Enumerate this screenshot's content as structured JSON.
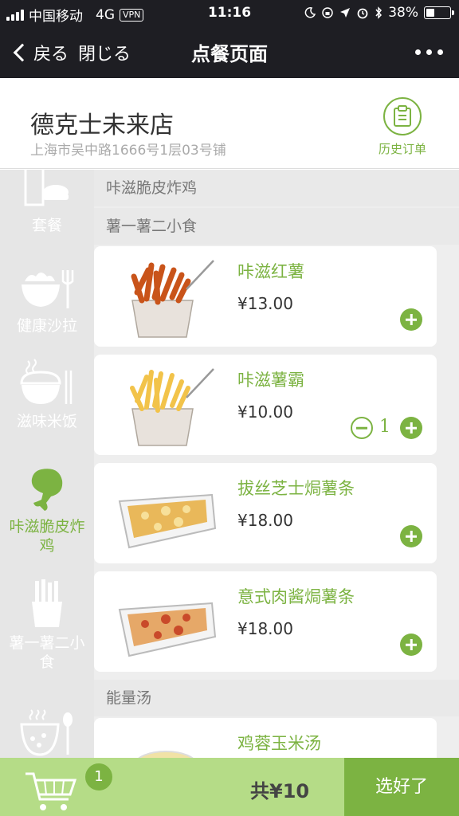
{
  "status_bar": {
    "carrier": "中国移动",
    "network": "4G",
    "vpn": "VPN",
    "time": "11:16",
    "battery": "38%",
    "battery_level": 0.38
  },
  "nav": {
    "back_label": "戻る",
    "close_label": "閉じる",
    "title": "点餐页面"
  },
  "store": {
    "name": "德克士未来店",
    "address": "上海市吴中路1666号1层03号铺",
    "history_label": "历史订单"
  },
  "sidebar": {
    "items": [
      {
        "label": "套餐",
        "icon": "combo-meal-icon",
        "active": false
      },
      {
        "label": "健康沙拉",
        "icon": "salad-bowl-icon",
        "active": false
      },
      {
        "label": "滋味米饭",
        "icon": "rice-bowl-icon",
        "active": false
      },
      {
        "label": "咔滋脆皮炸",
        "label2": "鸡",
        "icon": "chicken-drumstick-icon",
        "active": true
      },
      {
        "label": "薯一薯二小",
        "label2": "食",
        "icon": "fries-icon",
        "active": false
      },
      {
        "label": "",
        "icon": "soup-icon",
        "active": false
      }
    ]
  },
  "menu": {
    "sections": [
      "咔滋脆皮炸鸡",
      "薯一薯二小食",
      "能量汤"
    ],
    "items": [
      {
        "name": "咔滋红薯",
        "price": "¥13.00",
        "quantity": null,
        "image": "sweet-potato-fries-image"
      },
      {
        "name": "咔滋薯霸",
        "price": "¥10.00",
        "quantity": "1",
        "image": "french-fries-image"
      },
      {
        "name": "拔丝芝士焗薯条",
        "price": "¥18.00",
        "quantity": null,
        "image": "cheese-baked-fries-image"
      },
      {
        "name": "意式肉酱焗薯条",
        "price": "¥18.00",
        "quantity": null,
        "image": "bolognese-baked-fries-image"
      },
      {
        "name": "鸡蓉玉米汤",
        "price": "",
        "quantity": null,
        "image": "corn-soup-image"
      }
    ]
  },
  "cart": {
    "count": "1",
    "total": "共¥10",
    "checkout_label": "选好了"
  },
  "colors": {
    "accent": "#7cb342",
    "accent_light": "#b5dc87",
    "dark_bar": "#1e1e23"
  }
}
